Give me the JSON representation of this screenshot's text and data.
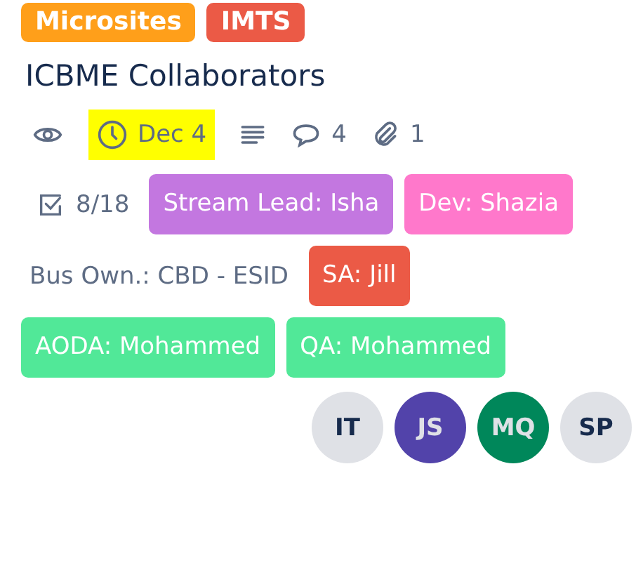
{
  "labels": [
    {
      "text": "Microsites",
      "color": "#ff9f1a"
    },
    {
      "text": "IMTS",
      "color": "#eb5a46"
    }
  ],
  "title": "ICBME Collaborators",
  "badges": [
    {
      "kind": "watch"
    },
    {
      "kind": "due",
      "text": "Dec 4",
      "highlighted": true
    },
    {
      "kind": "description"
    },
    {
      "kind": "comments",
      "text": "4"
    },
    {
      "kind": "attachments",
      "text": "1"
    }
  ],
  "details": [
    {
      "kind": "checklist",
      "text": "8/18"
    },
    {
      "kind": "label",
      "text": "Stream Lead: Isha",
      "color": "#c377e0"
    },
    {
      "kind": "label",
      "text": "Dev: Shazia",
      "color": "#ff78cb"
    },
    {
      "kind": "field",
      "text": "Bus Own.: CBD - ESID"
    },
    {
      "kind": "label",
      "text": "SA: Jill",
      "color": "#eb5a46"
    },
    {
      "kind": "label",
      "text": "AODA: Mohammed",
      "color": "#51e898"
    },
    {
      "kind": "label",
      "text": "QA: Mohammed",
      "color": "#51e898"
    }
  ],
  "members": [
    {
      "initials": "IT",
      "color": "#dfe1e6"
    },
    {
      "initials": "JS",
      "color": "#5243aa"
    },
    {
      "initials": "MQ",
      "color": "#00875a"
    },
    {
      "initials": "SP",
      "color": "#dfe1e6"
    }
  ]
}
